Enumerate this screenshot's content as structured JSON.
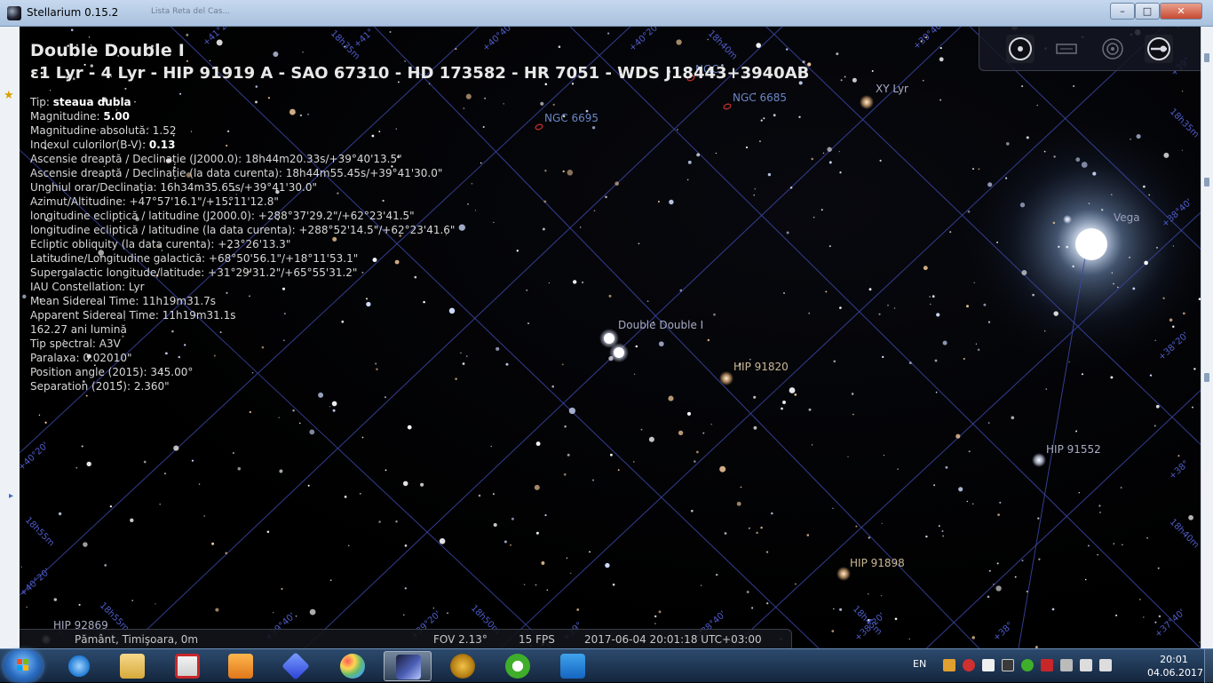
{
  "window": {
    "title": "Stellarium 0.15.2",
    "background_tab_text": "Lista Reta del Cas...",
    "min_label": "–",
    "max_label": "□",
    "close_label": "✕"
  },
  "object_info": {
    "title": "Double Double I",
    "subtitle": "ε1 Lyr - 4 Lyr - HIP 91919 A - SAO 67310 - HD 173582 - HR 7051 - WDS J18443+3940AB",
    "lines": [
      {
        "label": "Tip: ",
        "value": "steaua dubla"
      },
      {
        "label": "Magnitudine: ",
        "value": "5.00"
      },
      {
        "label": "Magnitudine absolută: 1.52",
        "value": ""
      },
      {
        "label": "Indexul culorilor(B-V): ",
        "value": "0.13"
      },
      {
        "label": "Ascensie dreaptă / Declinație (J2000.0): 18h44m20.33s/+39°40'13.5\"",
        "value": ""
      },
      {
        "label": "Ascensie dreaptă / Declinație (la data curenta): 18h44m55.45s/+39°41'30.0\"",
        "value": ""
      },
      {
        "label": "Unghiul orar/Declinația: 16h34m35.65s/+39°41'30.0\"",
        "value": ""
      },
      {
        "label": "Azimut/Altitudine: +47°57'16.1\"/+15°11'12.8\"",
        "value": ""
      },
      {
        "label": "longitudine ecliptică / latitudine (J2000.0): +288°37'29.2\"/+62°23'41.5\"",
        "value": ""
      },
      {
        "label": "longitudine ecliptică / latitudine (la data curenta): +288°52'14.5\"/+62°23'41.6\"",
        "value": ""
      },
      {
        "label": "Ecliptic obliquity (la data curenta): +23°26'13.3\"",
        "value": ""
      },
      {
        "label": "Latitudine/Longitudine galactică: +68°50'56.1\"/+18°11'53.1\"",
        "value": ""
      },
      {
        "label": "Supergalactic longitude/latitude: +31°29'31.2\"/+65°55'31.2\"",
        "value": ""
      },
      {
        "label": "IAU Constellation: Lyr",
        "value": ""
      },
      {
        "label": "Mean Sidereal Time: 11h19m31.7s",
        "value": ""
      },
      {
        "label": "Apparent Sidereal Time: 11h19m31.1s",
        "value": ""
      },
      {
        "label": "162.27 ani lumină",
        "value": ""
      },
      {
        "label": "Tip spectral: A3V",
        "value": ""
      },
      {
        "label": "Paralaxa: 0.02010\"",
        "value": ""
      },
      {
        "label": "Position angle (2015): 345.00°",
        "value": ""
      },
      {
        "label": "Separation (2015): 2.360\"",
        "value": ""
      }
    ]
  },
  "sky_labels": {
    "double_double": "Double Double I",
    "hip_91820": "HIP 91820",
    "hip_91552": "HIP 91552",
    "hip_91898": "HIP 91898",
    "hip_92869": "HIP 92869",
    "ngc_6695": "NGC 6695",
    "ngc_6685": "NGC 6685",
    "ngc_top": "NGC",
    "xy_lyr": "XY Lyr",
    "vega": "Vega"
  },
  "grid_labels": {
    "g1": "+41°20'",
    "g2": "18h35m",
    "g3": "+41°",
    "g4": "+40°40'",
    "g5": "+40°20'",
    "g6": "18h40m",
    "g7": "+39°40'",
    "g8": "+39°",
    "g9": "18h35m",
    "g10": "+38°40'",
    "g11": "+38°20'",
    "g12": "+38°",
    "g13": "18h40m",
    "g14": "+37°40'",
    "g15": "+40°20'",
    "g16": "18h55m",
    "g17": "+40°20'",
    "g18": "18h55m",
    "g19": "+39°40'",
    "g20": "+39°20'",
    "g21": "18h50m",
    "g22": "+39°",
    "g23": "+38°40'",
    "g24": "18h45m",
    "g25": "+38°20'",
    "g26": "+38°"
  },
  "status": {
    "location": "Pământ, Timişoara, 0m",
    "fov": "FOV 2.13°",
    "fps": "15 FPS",
    "datetime": "2017-06-04 20:01:18 UTC+03:00"
  },
  "taskbar": {
    "apps": [
      "ie-icon",
      "explorer-icon",
      "mail-icon",
      "media-player-icon",
      "cube-icon",
      "paint-icon",
      "stellarium-icon",
      "arrows-icon",
      "utorrent-icon",
      "maxthon-icon"
    ],
    "language": "EN",
    "time": "20:01",
    "date": "04.06.2017"
  },
  "colors": {
    "grid": "#3d48a8",
    "accent_blue": "#2a6cc0"
  }
}
